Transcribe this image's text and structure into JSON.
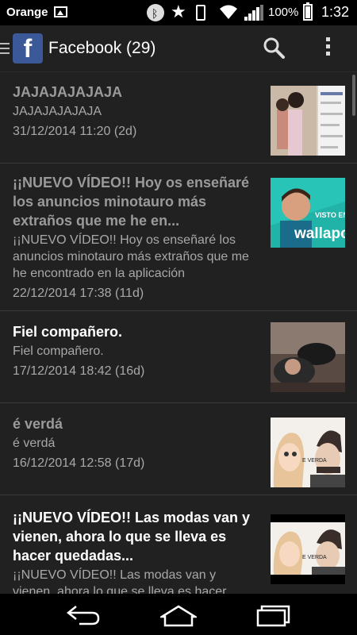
{
  "status": {
    "carrier": "Orange",
    "battery": "100%",
    "time": "1:32"
  },
  "appbar": {
    "title": "Facebook (29)",
    "logo_letter": "f"
  },
  "notifications": [
    {
      "title": "JAJAJAJAJAJA",
      "body": "JAJAJAJAJAJA",
      "date": "31/12/2014 11:20 (2d)",
      "read": true
    },
    {
      "title": "¡¡NUEVO VÍDEO!! Hoy os enseñaré los anuncios minotauro más extraños que me he en...",
      "body": "¡¡NUEVO VÍDEO!! Hoy os enseñaré los anuncios minotauro más extraños que me he encontrado en la aplicación",
      "date": "22/12/2014 17:38 (11d)",
      "read": true,
      "thumb_text": [
        "VISTO EN",
        "wallapop"
      ]
    },
    {
      "title": "Fiel compañero.",
      "body": "Fiel compañero.",
      "date": "17/12/2014 18:42 (16d)",
      "read": false
    },
    {
      "title": "é verdá",
      "body": "é verdá",
      "date": "16/12/2014 12:58 (17d)",
      "read": true,
      "thumb_text": [
        "E VERDA"
      ]
    },
    {
      "title": "¡¡NUEVO VÍDEO!! Las modas van y vienen, ahora lo que se lleva es hacer quedadas...",
      "body": "¡¡NUEVO VÍDEO!! Las modas van y vienen, ahora lo que se lleva es hacer",
      "read": false,
      "thumb_text": [
        "E VERDA"
      ]
    }
  ]
}
